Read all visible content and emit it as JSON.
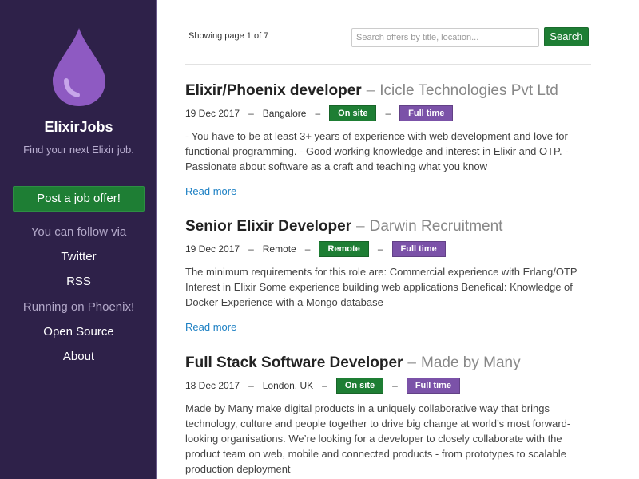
{
  "sidebar": {
    "brand": "ElixirJobs",
    "tagline": "Find your next Elixir job.",
    "post_button": "Post a job offer!",
    "follow_label": "You can follow via",
    "twitter": "Twitter",
    "rss": "RSS",
    "running_label": "Running on Phoenix!",
    "open_source": "Open Source",
    "about": "About",
    "logo_color": "#8e5ac2"
  },
  "header": {
    "showing": "Showing page 1 of 7",
    "search_placeholder": "Search offers by title, location...",
    "search_button": "Search"
  },
  "jobs": [
    {
      "title": "Elixir/Phoenix developer",
      "company": "Icicle Technologies Pvt Ltd",
      "date": "19 Dec 2017",
      "location": "Bangalore",
      "place": "On site",
      "type": "Full time",
      "description": "- You have to be at least 3+ years of experience with web development and love for functional programming. - Good working knowledge and interest in Elixir and OTP. - Passionate about software as a craft and teaching what you know",
      "read_more": "Read more"
    },
    {
      "title": "Senior Elixir Developer",
      "company": "Darwin Recruitment",
      "date": "19 Dec 2017",
      "location": "Remote",
      "place": "Remote",
      "type": "Full time",
      "description": "The minimum requirements for this role are: Commercial experience with Erlang/OTP Interest in Elixir Some experience building web applications Benefical: Knowledge of Docker Experience with a Mongo database",
      "read_more": "Read more"
    },
    {
      "title": "Full Stack Software Developer",
      "company": "Made by Many",
      "date": "18 Dec 2017",
      "location": "London, UK",
      "place": "On site",
      "type": "Full time",
      "description": "Made by Many make digital products in a uniquely collaborative way that brings technology, culture and people together to drive big change at world’s most forward-looking organisations. We’re looking for a developer to closely collaborate with the product team on web, mobile and connected products - from prototypes to scalable production deployment",
      "read_more": ""
    }
  ]
}
